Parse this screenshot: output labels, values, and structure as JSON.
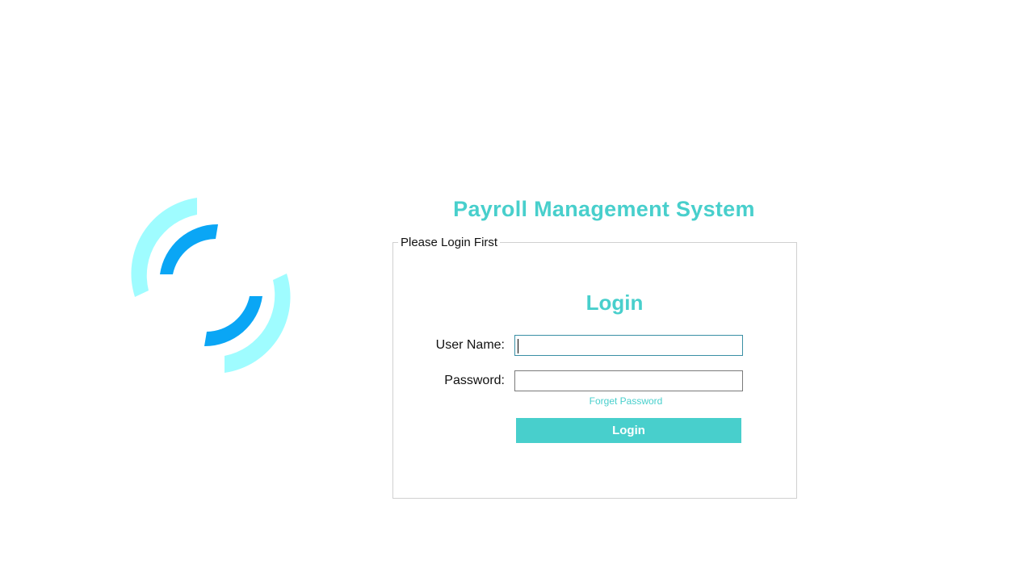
{
  "app": {
    "title": "Payroll Management System"
  },
  "logo": {
    "icon": "signal-waves-logo",
    "colors": {
      "outer": "#9ffcff",
      "inner": "#0aa6f5"
    }
  },
  "login_group": {
    "legend": "Please Login First",
    "heading": "Login",
    "username": {
      "label": "User Name:",
      "value": "",
      "placeholder": ""
    },
    "password": {
      "label": "Password:",
      "value": "",
      "placeholder": ""
    },
    "forget_password_link": "Forget Password",
    "login_button": "Login"
  },
  "colors": {
    "accent": "#48cfcc",
    "border": "#d0d0d0"
  }
}
